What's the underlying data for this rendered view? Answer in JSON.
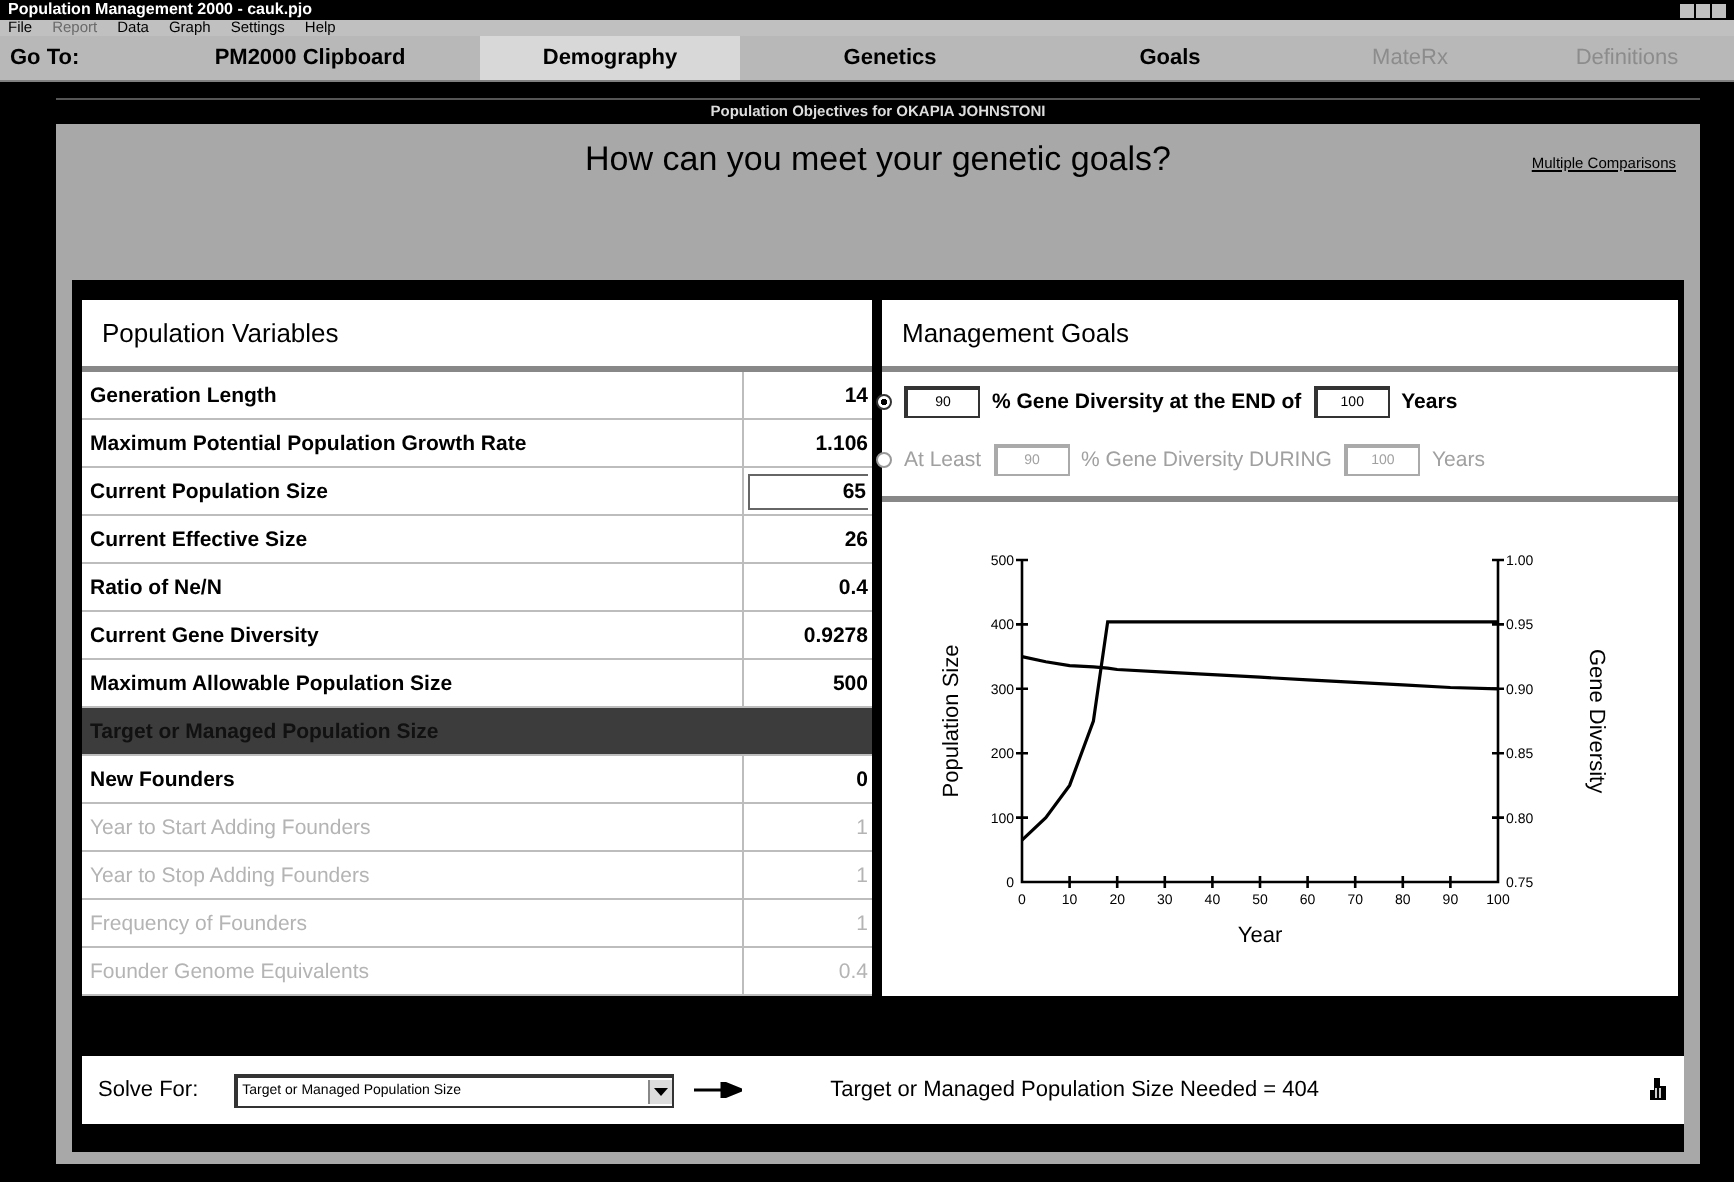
{
  "window": {
    "title": "Population Management 2000 - cauk.pjo"
  },
  "menu": [
    {
      "label": "File",
      "disabled": false
    },
    {
      "label": "Report",
      "disabled": true
    },
    {
      "label": "Data",
      "disabled": false
    },
    {
      "label": "Graph",
      "disabled": false
    },
    {
      "label": "Settings",
      "disabled": false
    },
    {
      "label": "Help",
      "disabled": false
    }
  ],
  "nav": {
    "label": "Go To:",
    "items": [
      {
        "label": "PM2000 Clipboard",
        "selected": false,
        "disabled": false
      },
      {
        "label": "Demography",
        "selected": true,
        "disabled": false
      },
      {
        "label": "Genetics",
        "selected": false,
        "disabled": false
      },
      {
        "label": "Goals",
        "selected": false,
        "disabled": false
      },
      {
        "label": "MateRx",
        "selected": false,
        "disabled": true
      },
      {
        "label": "Definitions",
        "selected": false,
        "disabled": true
      }
    ]
  },
  "panel": {
    "title": "Population Objectives for OKAPIA JOHNSTONI",
    "question": "How can you meet your genetic goals?",
    "link": "Multiple Comparisons"
  },
  "variables": {
    "title": "Population Variables",
    "rows": [
      {
        "label": "Generation Length",
        "value": "14",
        "kind": "text",
        "selected": false,
        "disabled": false
      },
      {
        "label": "Maximum Potential Population Growth Rate",
        "value": "1.106",
        "kind": "text",
        "selected": false,
        "disabled": false
      },
      {
        "label": "Current Population Size",
        "value": "65",
        "kind": "input",
        "selected": false,
        "disabled": false
      },
      {
        "label": "Current Effective Size",
        "value": "26",
        "kind": "text",
        "selected": false,
        "disabled": false
      },
      {
        "label": "Ratio of Ne/N",
        "value": "0.4",
        "kind": "text",
        "selected": false,
        "disabled": false
      },
      {
        "label": "Current Gene Diversity",
        "value": "0.9278",
        "kind": "text",
        "selected": false,
        "disabled": false
      },
      {
        "label": "Maximum Allowable Population Size",
        "value": "500",
        "kind": "text",
        "selected": false,
        "disabled": false
      },
      {
        "label": "Target or Managed Population Size",
        "kind": "text",
        "selected": true,
        "disabled": false
      },
      {
        "label": "New Founders",
        "value": "0",
        "kind": "text",
        "selected": false,
        "disabled": false
      },
      {
        "label": "Year to Start Adding Founders",
        "value": "1",
        "kind": "text",
        "selected": false,
        "disabled": true
      },
      {
        "label": "Year to Stop Adding Founders",
        "value": "1",
        "kind": "text",
        "selected": false,
        "disabled": true
      },
      {
        "label": "Frequency of Founders",
        "value": "1",
        "kind": "text",
        "selected": false,
        "disabled": true
      },
      {
        "label": "Founder Genome Equivalents",
        "value": "0.4",
        "kind": "text",
        "selected": false,
        "disabled": true
      }
    ]
  },
  "goals": {
    "title": "Management Goals",
    "options": [
      {
        "selected": true,
        "disabled": false,
        "parts": [
          {
            "kind": "field",
            "value": "90"
          },
          {
            "kind": "text",
            "text": "% Gene Diversity at the END of"
          },
          {
            "kind": "field",
            "value": "100"
          },
          {
            "kind": "text",
            "text": "Years"
          }
        ]
      },
      {
        "selected": false,
        "disabled": true,
        "parts": [
          {
            "kind": "text",
            "text": "At Least"
          },
          {
            "kind": "field",
            "value": "90"
          },
          {
            "kind": "text",
            "text": "% Gene Diversity DURING"
          },
          {
            "kind": "field",
            "value": "100"
          },
          {
            "kind": "text",
            "text": "Years"
          }
        ]
      }
    ],
    "chart_data": {
      "type": "line",
      "xlabel": "Year",
      "ylabel": "Population Size",
      "y2label": "Gene Diversity",
      "x": [
        0,
        5,
        10,
        15,
        18,
        20,
        30,
        40,
        50,
        60,
        70,
        80,
        90,
        100
      ],
      "series": [
        {
          "color": "#000000",
          "values": [
            65,
            100,
            150,
            250,
            404,
            404,
            404,
            404,
            404,
            404,
            404,
            404,
            404,
            404
          ]
        },
        {
          "color": "#000000",
          "axis": "y2",
          "values": [
            0.925,
            0.921,
            0.918,
            0.917,
            0.916,
            0.915,
            0.913,
            0.911,
            0.909,
            0.907,
            0.905,
            0.903,
            0.901,
            0.9
          ]
        }
      ],
      "xlim": [
        0,
        100
      ],
      "ylim": [
        0,
        500
      ],
      "y2lim": [
        0.75,
        1.0
      ],
      "xticks": [
        0,
        10,
        20,
        30,
        40,
        50,
        60,
        70,
        80,
        90,
        100
      ],
      "yticks": [
        0,
        100,
        200,
        300,
        400,
        500
      ],
      "y2ticks": [
        {
          "value": 0.75,
          "label": "0.75"
        },
        {
          "value": 0.8,
          "label": "0.80"
        },
        {
          "value": 0.85,
          "label": "0.85"
        },
        {
          "value": 0.9,
          "label": "0.90"
        },
        {
          "value": 0.95,
          "label": "0.95"
        },
        {
          "value": 1.0,
          "label": "1.00"
        }
      ]
    }
  },
  "solve": {
    "label": "Solve For:",
    "value": "Target or Managed Population Size",
    "result": "Target or Managed Population Size Needed = 404"
  }
}
